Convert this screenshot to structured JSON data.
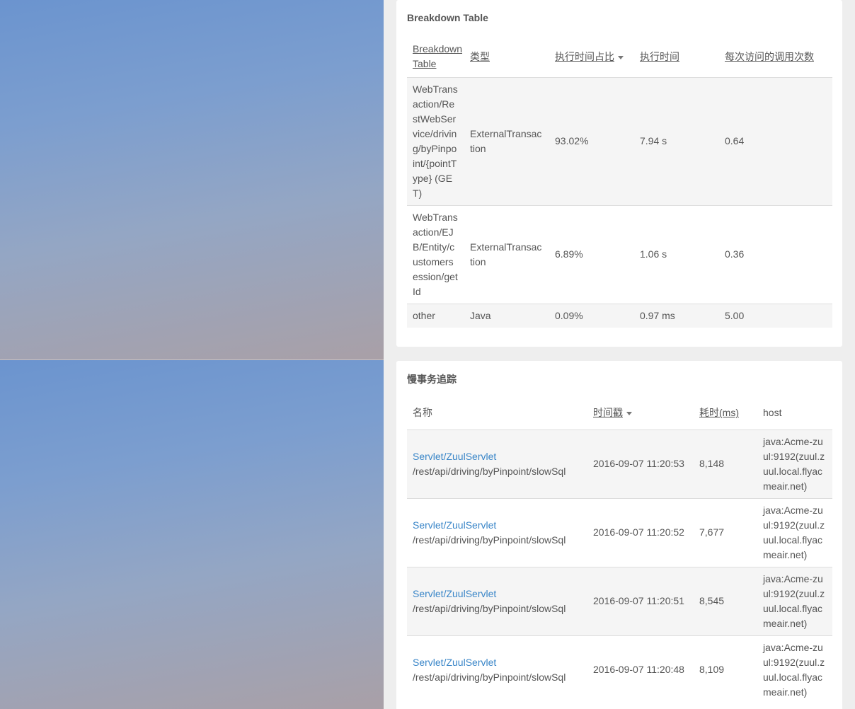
{
  "breakdown": {
    "title": "Breakdown Table",
    "columns": [
      "Breakdown Table",
      "类型",
      "执行时间占比",
      "执行时间",
      "每次访问的调用次数"
    ],
    "rows": [
      {
        "name": "WebTransaction/RestWebService/driving/byPinpoint/{pointType} (GET)",
        "type": "ExternalTransaction",
        "ratio": "93.02%",
        "time": "7.94 s",
        "calls": "0.64"
      },
      {
        "name": "WebTransaction/EJB/Entity/customersession/getId",
        "type": "ExternalTransaction",
        "ratio": "6.89%",
        "time": "1.06 s",
        "calls": "0.36"
      },
      {
        "name": "other",
        "type": "Java",
        "ratio": "0.09%",
        "time": "0.97 ms",
        "calls": "5.00"
      }
    ]
  },
  "slow_trace": {
    "title": "慢事务追踪",
    "columns": [
      "名称",
      "时间戳",
      "耗时(ms)",
      "host"
    ],
    "rows": [
      {
        "link": "Servlet/ZuulServlet",
        "path": "/rest/api/driving/byPinpoint/slowSql",
        "timestamp": "2016-09-07 11:20:53",
        "duration": "8,148",
        "host": "java:Acme-zuul:9192(zuul.zuul.local.flyacmeair.net)"
      },
      {
        "link": "Servlet/ZuulServlet",
        "path": "/rest/api/driving/byPinpoint/slowSql",
        "timestamp": "2016-09-07 11:20:52",
        "duration": "7,677",
        "host": "java:Acme-zuul:9192(zuul.zuul.local.flyacmeair.net)"
      },
      {
        "link": "Servlet/ZuulServlet",
        "path": "/rest/api/driving/byPinpoint/slowSql",
        "timestamp": "2016-09-07 11:20:51",
        "duration": "8,545",
        "host": "java:Acme-zuul:9192(zuul.zuul.local.flyacmeair.net)"
      },
      {
        "link": "Servlet/ZuulServlet",
        "path": "/rest/api/driving/byPinpoint/slowSql",
        "timestamp": "2016-09-07 11:20:48",
        "duration": "8,109",
        "host": "java:Acme-zuul:9192(zuul.zuul.local.flyacmeair.net)"
      }
    ]
  },
  "colors": {
    "link": "#3a86c8",
    "row_stripe": "#f5f5f5",
    "background": "#eeeeee"
  }
}
